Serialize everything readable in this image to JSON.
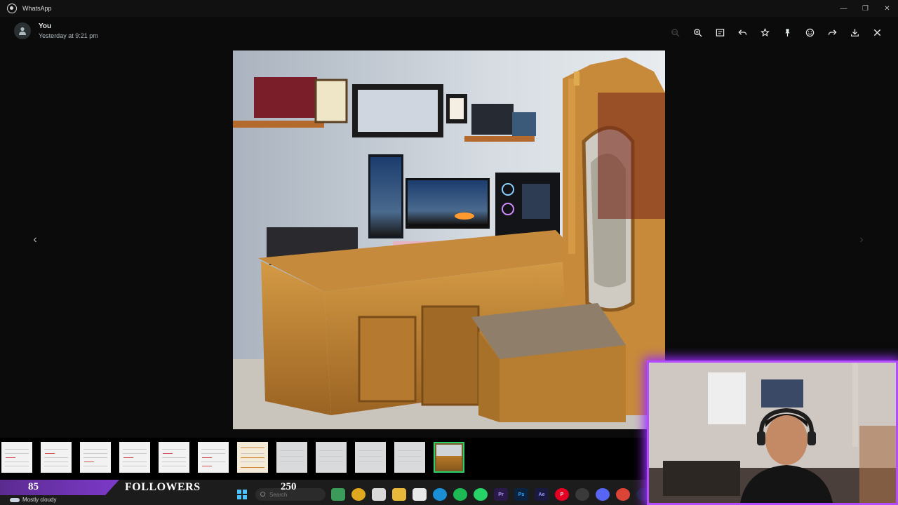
{
  "window": {
    "app_title": "WhatsApp",
    "controls": [
      "minimize",
      "restore",
      "close"
    ]
  },
  "viewer": {
    "sender_name": "You",
    "sender_time": "Yesterday at 9:21 pm",
    "toolbar": [
      {
        "name": "zoom-out",
        "icon": "zoom-out-icon",
        "disabled": true
      },
      {
        "name": "zoom-in",
        "icon": "zoom-in-icon",
        "disabled": false
      },
      {
        "name": "message",
        "icon": "message-icon",
        "disabled": false
      },
      {
        "name": "reply",
        "icon": "reply-icon",
        "disabled": false
      },
      {
        "name": "star",
        "icon": "star-icon",
        "disabled": false
      },
      {
        "name": "pin",
        "icon": "pin-icon",
        "disabled": false
      },
      {
        "name": "react",
        "icon": "emoji-icon",
        "disabled": false
      },
      {
        "name": "forward",
        "icon": "forward-icon",
        "disabled": false
      },
      {
        "name": "download",
        "icon": "download-icon",
        "disabled": false
      },
      {
        "name": "close",
        "icon": "close-icon",
        "disabled": false
      }
    ],
    "main_image": "photo of a carved wooden desk with a gaming PC setup and an ornate throne chair",
    "prev_arrow": "‹",
    "next_arrow": "›"
  },
  "thumbnails": [
    {
      "type": "document"
    },
    {
      "type": "document"
    },
    {
      "type": "document"
    },
    {
      "type": "document"
    },
    {
      "type": "document"
    },
    {
      "type": "document"
    },
    {
      "type": "document"
    },
    {
      "type": "plain"
    },
    {
      "type": "plain"
    },
    {
      "type": "plain"
    },
    {
      "type": "plain"
    },
    {
      "type": "photo",
      "active": true
    }
  ],
  "stream_overlay": {
    "count": "85",
    "label": "FOLLOWERS",
    "goal": "250"
  },
  "taskbar": {
    "weather": "Mostly cloudy",
    "search_placeholder": "Search",
    "apps": [
      "photos",
      "chrome-canary",
      "file",
      "explorer",
      "store",
      "edge",
      "spotify",
      "whatsapp",
      "premiere",
      "photoshop",
      "after-effects",
      "pinterest",
      "obs",
      "discord",
      "chrome",
      "steam"
    ]
  },
  "colors": {
    "accent_green": "#25d366",
    "stream_purple": "#b44dff",
    "background": "#0b0b0b"
  }
}
